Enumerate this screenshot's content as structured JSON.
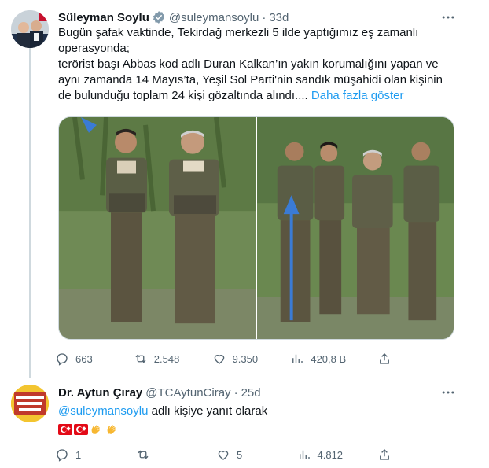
{
  "tweet": {
    "author": {
      "display_name": "Süleyman Soylu",
      "handle": "@suleymansoylu",
      "time": "33d",
      "verified": true
    },
    "text_lines": [
      "Bugün şafak vaktinde, Tekirdağ merkezli 5 ilde yaptığımız eş zamanlı",
      "operasyonda;",
      "terörist başı Abbas kod adlı Duran Kalkan’ın yakın korumalığını yapan ve",
      "aynı zamanda 14 Mayıs’ta, Yeşil Sol Parti'nin sandık müşahidi olan kişinin",
      "de bulunduğu toplam 24 kişi gözaltında alındı...."
    ],
    "show_more": "Daha fazla göster",
    "stats": {
      "replies": "663",
      "retweets": "2.548",
      "likes": "9.350",
      "views": "420,8 B"
    },
    "media": [
      {
        "icon": "group-photo-two-men"
      },
      {
        "icon": "group-photo-four-men-with-arrow"
      }
    ]
  },
  "reply": {
    "author": {
      "display_name": "Dr. Aytun Çıray",
      "handle": "@TCAytunCiray",
      "time": "25d"
    },
    "reply_mention": "@suleymansoylu",
    "reply_suffix": "adlı kişiye yanıt olarak",
    "emoji": [
      "turkey-flag",
      "turkey-flag",
      "clapping-hands",
      "clapping-hands"
    ],
    "stats": {
      "replies": "1",
      "retweets": "",
      "likes": "5",
      "views": "4.812"
    }
  },
  "colors": {
    "accent": "#1d9bf0",
    "secondary_text": "#536471",
    "border": "#eff3f4"
  }
}
